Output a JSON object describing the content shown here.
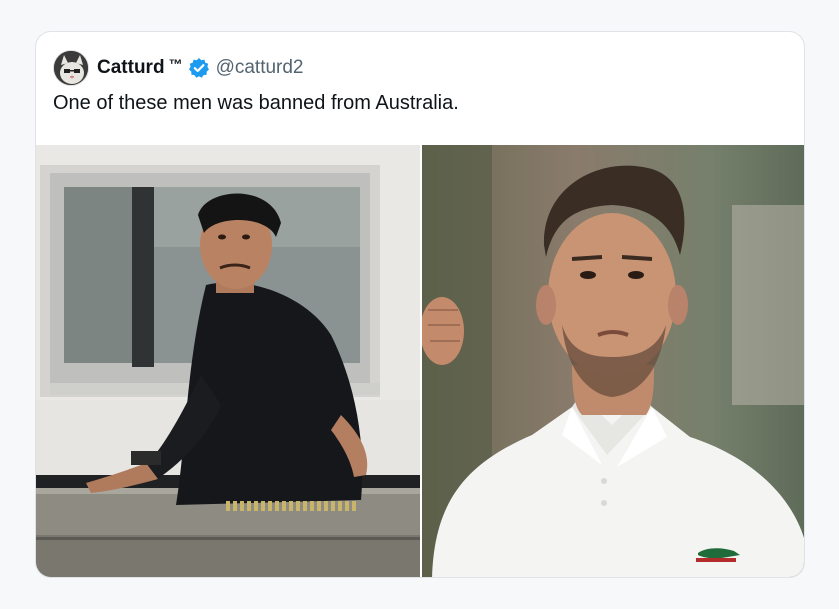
{
  "tweet": {
    "author": {
      "display_name": "Catturd",
      "tm": "™",
      "handle": "@catturd2",
      "verified": true,
      "avatar_icon": "cat-avatar-icon"
    },
    "text": "One of these men was banned from Australia.",
    "media": [
      {
        "name": "left-photo",
        "description_icon": "man-on-ledge-photo"
      },
      {
        "name": "right-photo",
        "description_icon": "tennis-player-photo"
      }
    ]
  },
  "colors": {
    "verified_blue": "#1d9bf0",
    "handle_gray": "#536471",
    "text_dark": "#0f1419"
  }
}
